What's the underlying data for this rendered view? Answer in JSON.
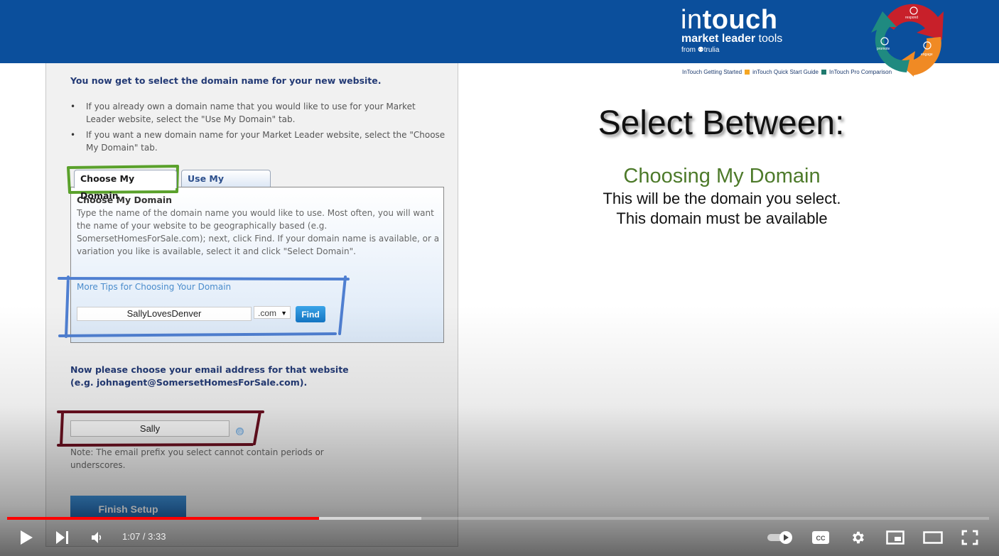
{
  "banner": {
    "logo_light": "in",
    "logo_bold": "touch",
    "tagline_bold": "market leader",
    "tagline_light": " tools",
    "from_text": "from ⚉trulia",
    "cycle_labels": [
      "respond",
      "engage",
      "promote"
    ],
    "links": [
      "InTouch Getting Started",
      "inTouch Quick Start Guide",
      "InTouch Pro Comparison"
    ],
    "link_separator_colors": [
      "#f5a623",
      "#1f7a6e"
    ]
  },
  "form": {
    "heading": "You now get to select the domain name for your new website.",
    "bullets": [
      "If you already own a domain name that you would like to use for your Market Leader website, select the \"Use My Domain\" tab.",
      "If you want a new domain name for your Market Leader website, select the \"Choose My Domain\" tab."
    ],
    "tabs": [
      {
        "label": "Choose My Domain",
        "active": true
      },
      {
        "label": "Use My Domain",
        "active": false
      }
    ],
    "tab_panel": {
      "title": "Choose My Domain",
      "body": "Type the name of the domain name you would like to use. Most often, you will want the name of your website to be geographically based (e.g. SomersetHomesForSale.com); next, click Find. If your domain name is available, or a variation you like is available, select it and click \"Select Domain\".",
      "tips_link": "More Tips for Choosing Your Domain",
      "domain_value": "SallyLovesDenver",
      "tld_selected": ".com",
      "find_label": "Find"
    },
    "email_heading_line1": "Now please choose your email address for that website",
    "email_heading_line2": "(e.g. johnagent@SomersetHomesForSale.com).",
    "email_prefix_value": "Sally",
    "at_symbol": "@",
    "note": "Note: The email prefix you select cannot contain periods or underscores.",
    "finish_label": "Finish Setup"
  },
  "slide": {
    "title": "Select Between:",
    "subtitle": "Choosing My Domain",
    "lines": [
      "This will be the domain you select.",
      "This domain must be available"
    ]
  },
  "annotations": {
    "green": "#5aa12b",
    "blue": "#4f7fd1",
    "maroon": "#6b1020"
  },
  "player": {
    "current_time": "1:07",
    "duration": "3:33",
    "time_display": "1:07 / 3:33",
    "played_fraction": 0.318,
    "buffered_fraction": 0.422,
    "accent_color": "#ff0000"
  }
}
